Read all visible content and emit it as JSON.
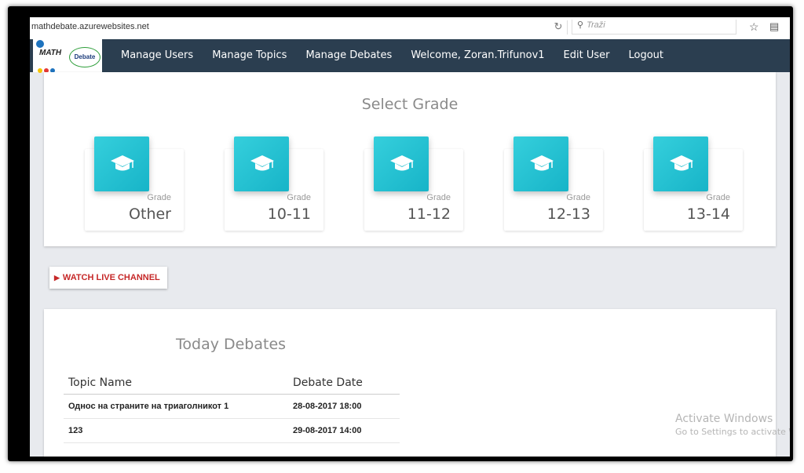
{
  "browser": {
    "url": "mathdebate.azurewebsites.net",
    "search_placeholder": "Traži",
    "icons": [
      "refresh-icon",
      "search-icon",
      "star-icon",
      "menu-icon"
    ]
  },
  "logo": {
    "math": "MATH",
    "debate": "Debate"
  },
  "nav": {
    "items": [
      "Manage Users",
      "Manage Topics",
      "Manage Debates",
      "Welcome, Zoran.Trifunov1",
      "Edit User",
      "Logout"
    ]
  },
  "grades": {
    "title": "Select Grade",
    "cards": [
      {
        "label": "Grade",
        "value": "Other"
      },
      {
        "label": "Grade",
        "value": "10-11"
      },
      {
        "label": "Grade",
        "value": "11-12"
      },
      {
        "label": "Grade",
        "value": "12-13"
      },
      {
        "label": "Grade",
        "value": "13-14"
      }
    ]
  },
  "live": {
    "label": "WATCH LIVE CHANNEL"
  },
  "debates": {
    "title": "Today Debates",
    "headers": [
      "Topic Name",
      "Debate Date"
    ],
    "rows": [
      [
        "Однос на страните на триаголникот 1",
        "28-08-2017 18:00"
      ],
      [
        "123",
        "29-08-2017 14:00"
      ]
    ]
  },
  "watermark": {
    "line1": "Activate Windows",
    "line2": "Go to Settings to activate W"
  },
  "colors": {
    "navbar": "#2b3e50",
    "tile": "#22bfcf",
    "live_text": "#c62828"
  }
}
